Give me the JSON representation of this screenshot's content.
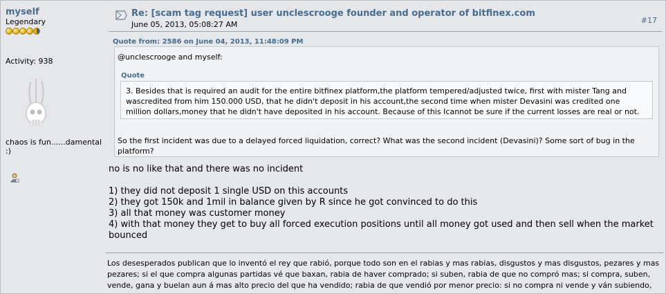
{
  "poster": {
    "name": "myself",
    "rank": "Legendary",
    "activity": "Activity: 938",
    "personal_text": "chaos is fun......damental :)",
    "rank_coins": 5
  },
  "post": {
    "subject": "Re: [scam tag request] user unclescrooge founder and operator of bitfinex.com",
    "date": "June 05, 2013, 05:08:27 AM",
    "number": "#17"
  },
  "quote": {
    "header": "Quote from: 2586 on June 04, 2013, 11:48:09 PM",
    "intro": "@unclescrooge and myself:",
    "inner_header": "Quote",
    "inner_text": "3. Besides that is required an audit for the entire bitfinex platform,the platform tempered/adjusted twice, first with mister Tang and wascredited from him 150.000 USD, that he didn't deposit in his account,the second time when mister Devasini was credited one million dollars,money that he didn't have deposited in his account. Because of this Icannot be sure if the current losses are real or not.",
    "after": "So the first incident was due to a delayed forced liquidation, correct? What was the second incident (Devasini)? Some sort of bug in the platform?"
  },
  "reply": {
    "line1": "no is no like that and there was no incident",
    "items": [
      "1) they did not deposit 1 single USD on this accounts",
      "2) they got 150k and 1mil in balance given by R since he got convinced to do this",
      "3) all that money was customer money",
      "4) with that money they get to buy all forced execution positions until all money got used and then sell when the market bounced"
    ]
  },
  "signature": {
    "text": "Los desesperados publican que lo inventó el rey que rabió, porque todo son en el rabias y mas rabias, disgustos y mas disgustos, pezares y mas pezares; si el que compra algunas partidas vé que baxan, rabia de haver comprado; si suben, rabia de que no compró mas; si compra, suben, vende, gana y buelan aun á mas alto precio del que ha vendido; rabia de que vendió por menor precio: si no compra ni vende y ván subiendo,"
  },
  "colors": {
    "link": "#476c8e",
    "background": "#e5e7ea",
    "quote_bg": "#f1f2f4"
  },
  "icons": {
    "post_icon": "message-icon",
    "profile": "profile-icon"
  }
}
